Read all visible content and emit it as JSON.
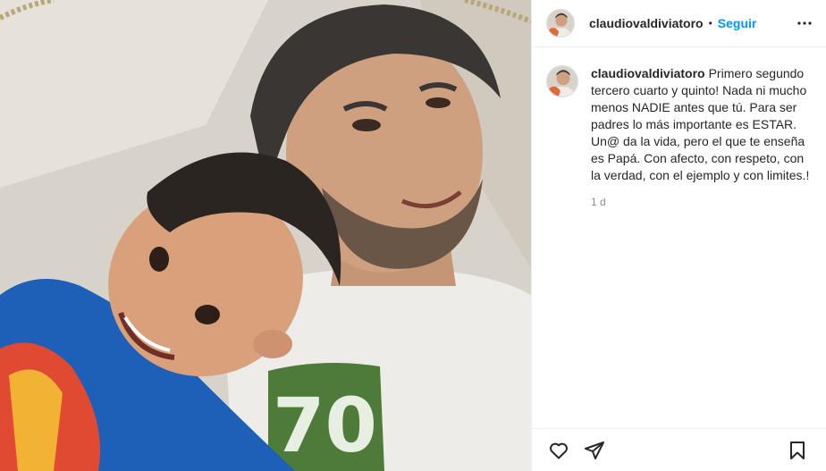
{
  "post": {
    "username": "claudiovaldiviatoro",
    "separator": "•",
    "follow_label": "Seguir",
    "caption": "Primero segundo tercero cuarto y quinto! Nada ni mucho menos NADIE antes que tú. Para ser padres lo más importante es ESTAR. Un@ da la vida, pero el que te enseña es Papá. Con afecto, con respeto, con la verdad, con el ejemplo y con limites.!",
    "timestamp": "1 d"
  },
  "photo": {
    "graphic_text": "70"
  },
  "icons": {
    "more": "more-options-icon",
    "like": "heart-icon",
    "share": "paper-plane-icon",
    "save": "bookmark-icon"
  },
  "colors": {
    "follow": "#0095f6",
    "text": "#262626",
    "muted": "#8e8e8e",
    "border": "#efefef"
  }
}
